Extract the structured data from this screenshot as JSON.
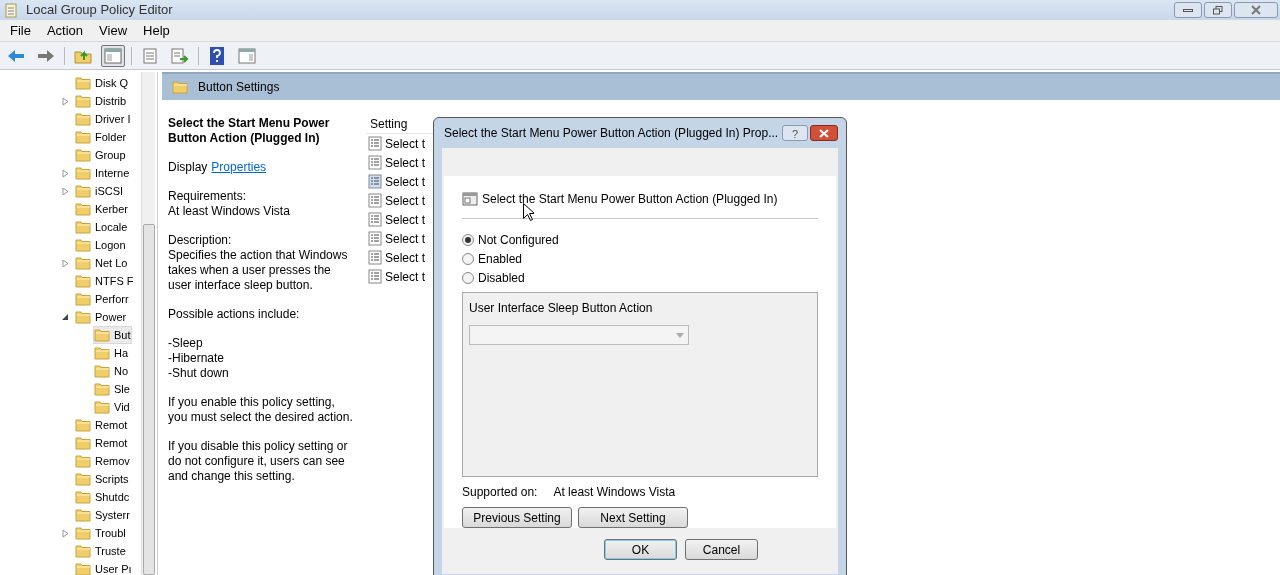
{
  "window": {
    "title": "Local Group Policy Editor"
  },
  "menu": [
    "File",
    "Action",
    "View",
    "Help"
  ],
  "toolbar": [
    {
      "kind": "back",
      "pressed": false
    },
    {
      "kind": "forward",
      "pressed": false
    },
    {
      "kind": "up",
      "pressed": false
    },
    {
      "kind": "tree",
      "pressed": true
    },
    {
      "kind": "properties",
      "pressed": false
    },
    {
      "kind": "export",
      "pressed": false
    },
    {
      "kind": "help",
      "pressed": false
    },
    {
      "kind": "pane",
      "pressed": false
    }
  ],
  "tree": [
    {
      "label": "Disk Q",
      "selected": false
    },
    {
      "label": "Distrib",
      "expanded": false,
      "selected": false
    },
    {
      "label": "Driver I",
      "selected": false
    },
    {
      "label": "Folder",
      "selected": false
    },
    {
      "label": "Group",
      "selected": false
    },
    {
      "label": "Interne",
      "expanded": false,
      "selected": false
    },
    {
      "label": "iSCSI",
      "expanded": false,
      "selected": false
    },
    {
      "label": "Kerber",
      "selected": false
    },
    {
      "label": "Locale",
      "selected": false
    },
    {
      "label": "Logon",
      "selected": false
    },
    {
      "label": "Net Lo",
      "expanded": false,
      "selected": false
    },
    {
      "label": "NTFS F",
      "selected": false
    },
    {
      "label": "Perforr",
      "selected": false
    },
    {
      "label": "Power",
      "expanded": true,
      "selected": false,
      "children": [
        {
          "label": "But",
          "selected": true
        },
        {
          "label": "Ha",
          "selected": false
        },
        {
          "label": "No",
          "selected": false
        },
        {
          "label": "Sle",
          "selected": false
        },
        {
          "label": "Vid",
          "selected": false
        }
      ]
    },
    {
      "label": "Remot",
      "selected": false
    },
    {
      "label": "Remot",
      "selected": false
    },
    {
      "label": "Remov",
      "selected": false
    },
    {
      "label": "Scripts",
      "selected": false
    },
    {
      "label": "Shutdc",
      "selected": false
    },
    {
      "label": "Systerr",
      "selected": false
    },
    {
      "label": "Troubl",
      "expanded": false,
      "selected": false
    },
    {
      "label": "Truste",
      "selected": false
    },
    {
      "label": "User Pı",
      "selected": false
    }
  ],
  "header": {
    "title": "Button Settings"
  },
  "description": {
    "title": "Select the Start Menu Power Button Action (Plugged In)",
    "display_label": "Display",
    "display_link": "Properties",
    "paragraphs": [
      "Requirements:\nAt least Windows Vista",
      "Description:\nSpecifies the action that Windows takes when a user presses the user interface sleep button.",
      "Possible actions include:",
      "-Sleep\n-Hibernate\n-Shut down",
      "If you enable this policy setting, you must select the desired action.",
      "If you disable this policy setting or do not configure it, users can see and change this setting."
    ]
  },
  "settings": {
    "column": "Setting",
    "rows": [
      {
        "label": "Select t",
        "selected": false
      },
      {
        "label": "Select t",
        "selected": false
      },
      {
        "label": "Select t",
        "selected": true
      },
      {
        "label": "Select t",
        "selected": false
      },
      {
        "label": "Select t",
        "selected": false
      },
      {
        "label": "Select t",
        "selected": false
      },
      {
        "label": "Select t",
        "selected": false
      },
      {
        "label": "Select t",
        "selected": false
      }
    ]
  },
  "dialog": {
    "title": "Select the Start Menu Power Button Action (Plugged In) Prop...",
    "help": "?",
    "heading": "Select the Start Menu Power Button Action (Plugged In)",
    "options": [
      {
        "label": "Not Configured",
        "selected": true
      },
      {
        "label": "Enabled",
        "selected": false
      },
      {
        "label": "Disabled",
        "selected": false
      }
    ],
    "options_box": {
      "label": "User Interface Sleep Button Action",
      "dropdown_disabled": true
    },
    "supported_label": "Supported on:",
    "supported_value": "At least Windows Vista",
    "nav_buttons": [
      "Previous Setting",
      "Next Setting"
    ],
    "buttons": [
      "OK",
      "Cancel"
    ]
  }
}
